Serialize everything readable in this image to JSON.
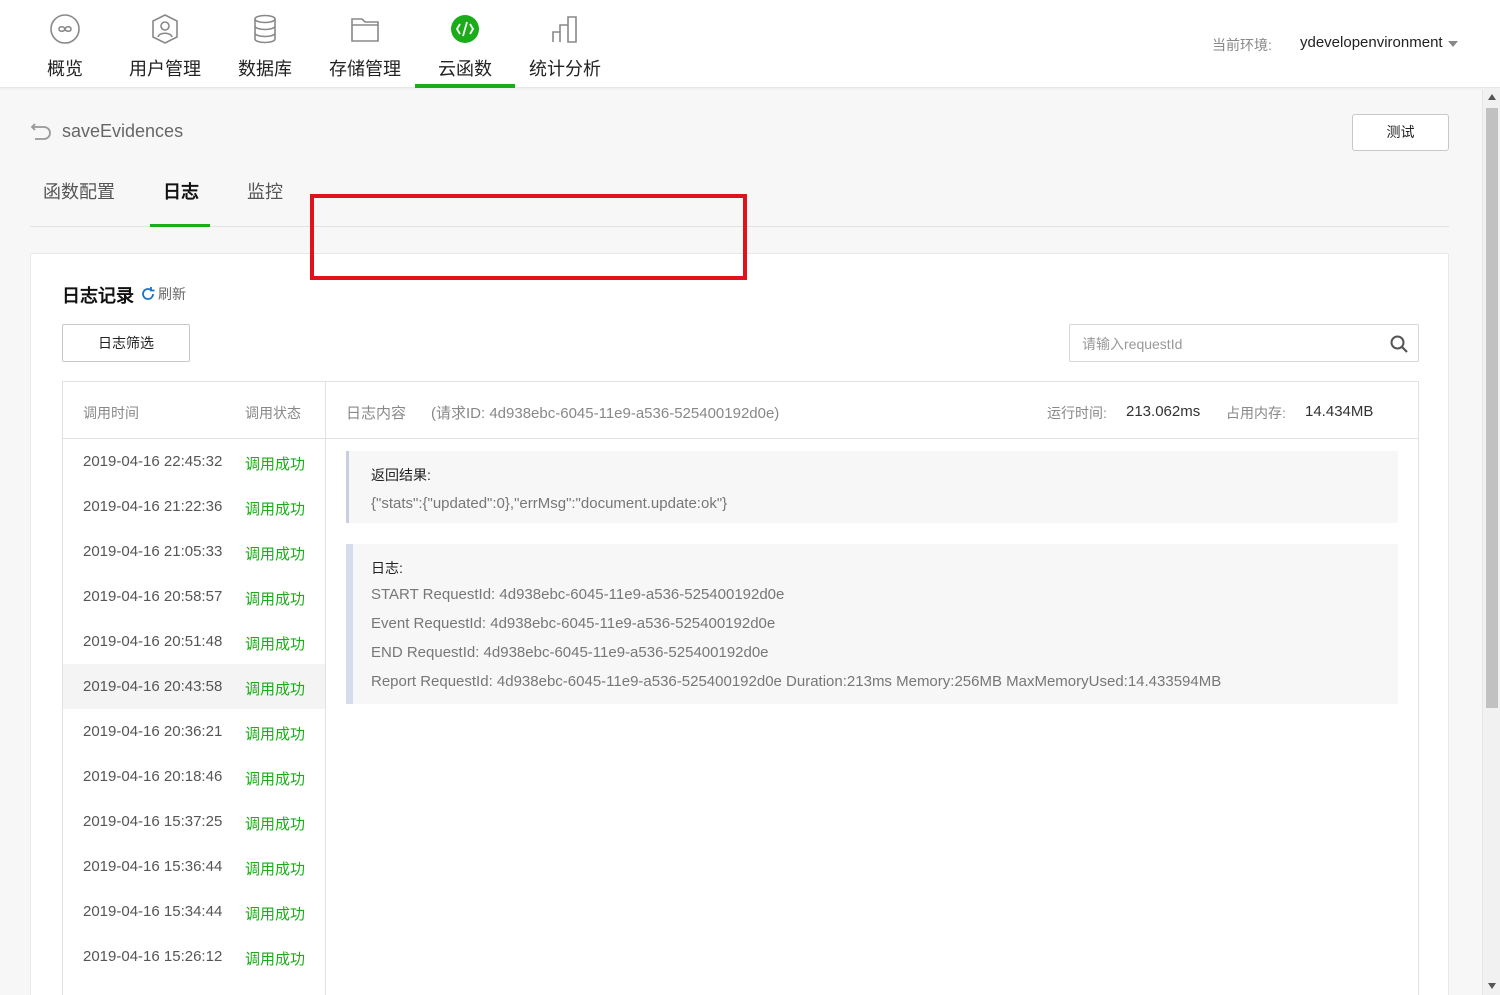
{
  "nav": {
    "items": [
      {
        "label": "概览",
        "icon": "infinity-icon"
      },
      {
        "label": "用户管理",
        "icon": "user-icon"
      },
      {
        "label": "数据库",
        "icon": "database-icon"
      },
      {
        "label": "存储管理",
        "icon": "folder-icon"
      },
      {
        "label": "云函数",
        "icon": "cloud-function-icon"
      },
      {
        "label": "统计分析",
        "icon": "chart-icon"
      }
    ],
    "active_index": 4,
    "env_label": "当前环境:",
    "env_value": "ydevelopenvironment",
    "accent_color": "#1aad19"
  },
  "function": {
    "name": "saveEvidences",
    "test_label": "测试"
  },
  "tabs": [
    {
      "label": "函数配置"
    },
    {
      "label": "日志"
    },
    {
      "label": "监控"
    }
  ],
  "logs": {
    "title": "日志记录",
    "refresh_label": "刷新",
    "filter_label": "日志筛选",
    "search_placeholder": "请输入requestId",
    "col_time": "调用时间",
    "col_status": "调用状态",
    "rows": [
      {
        "time": "2019-04-16 22:45:32",
        "status": "调用成功"
      },
      {
        "time": "2019-04-16 21:22:36",
        "status": "调用成功"
      },
      {
        "time": "2019-04-16 21:05:33",
        "status": "调用成功"
      },
      {
        "time": "2019-04-16 20:58:57",
        "status": "调用成功"
      },
      {
        "time": "2019-04-16 20:51:48",
        "status": "调用成功"
      },
      {
        "time": "2019-04-16 20:43:58",
        "status": "调用成功"
      },
      {
        "time": "2019-04-16 20:36:21",
        "status": "调用成功"
      },
      {
        "time": "2019-04-16 20:18:46",
        "status": "调用成功"
      },
      {
        "time": "2019-04-16 15:37:25",
        "status": "调用成功"
      },
      {
        "time": "2019-04-16 15:36:44",
        "status": "调用成功"
      },
      {
        "time": "2019-04-16 15:34:44",
        "status": "调用成功"
      },
      {
        "time": "2019-04-16 15:26:12",
        "status": "调用成功"
      }
    ],
    "selected_index": 5
  },
  "detail": {
    "content_label": "日志内容",
    "request_id_text": "(请求ID: 4d938ebc-6045-11e9-a536-525400192d0e)",
    "run_time_label": "运行时间:",
    "run_time_value": "213.062ms",
    "memory_label": "占用内存:",
    "memory_value": "14.434MB",
    "result_title": "返回结果:",
    "result_value": "{\"stats\":{\"updated\":0},\"errMsg\":\"document.update:ok\"}",
    "log_title": "日志:",
    "log_lines": [
      "START RequestId: 4d938ebc-6045-11e9-a536-525400192d0e",
      "Event RequestId: 4d938ebc-6045-11e9-a536-525400192d0e",
      "END RequestId: 4d938ebc-6045-11e9-a536-525400192d0e",
      "Report RequestId: 4d938ebc-6045-11e9-a536-525400192d0e Duration:213ms Memory:256MB MaxMemoryUsed:14.433594MB"
    ],
    "highlight_color": "#e0121b"
  }
}
